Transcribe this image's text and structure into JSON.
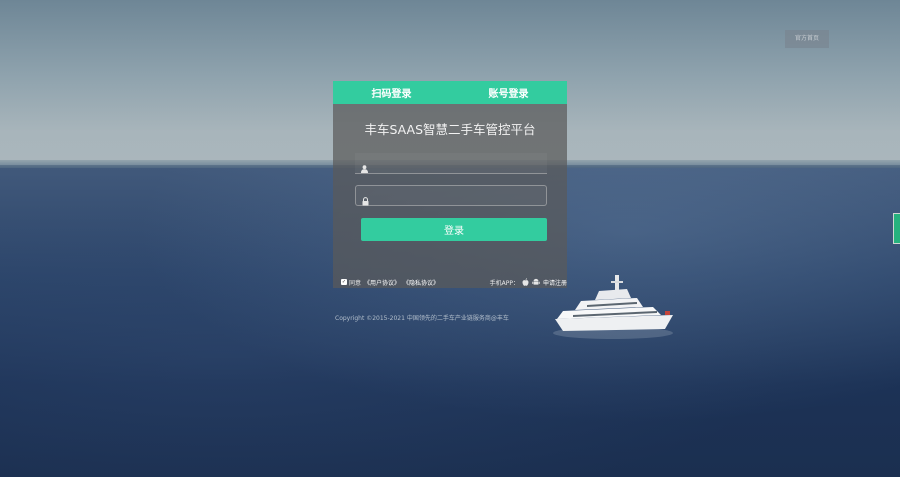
{
  "header": {
    "top_right_button": "官方首页"
  },
  "login": {
    "tabs": [
      {
        "label": "扫码登录"
      },
      {
        "label": "账号登录"
      }
    ],
    "title": "丰车SAAS智慧二手车管控平台",
    "username": {
      "value": "",
      "placeholder": ""
    },
    "password": {
      "value": "",
      "placeholder": ""
    },
    "submit_label": "登录",
    "agree_text": "同意",
    "user_agreement": "《用户协议》",
    "privacy_policy": "《隐私协议》",
    "app_label": "手机APP：",
    "register_label": "申请注册"
  },
  "footer": {
    "copyright": "Copyright ©2015-2021 中国领先的二手车产业链服务商@丰车"
  },
  "colors": {
    "accent": "#33cc9f"
  },
  "icons": [
    "user-icon",
    "lock-icon",
    "apple-icon",
    "android-icon",
    "check-icon"
  ]
}
